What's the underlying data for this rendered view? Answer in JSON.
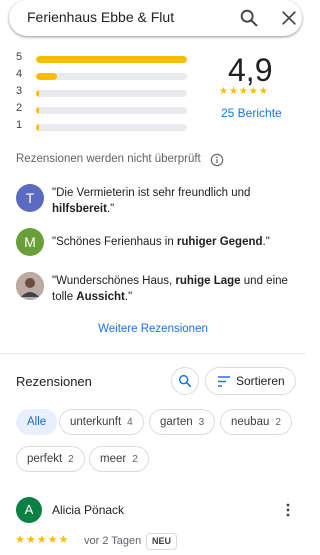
{
  "search": {
    "query": "Ferienhaus Ebbe & Flut",
    "search_icon": "search-icon",
    "close_icon": "close-icon"
  },
  "rating": {
    "score": "4,9",
    "stars_display": "★★★★★",
    "review_count_label": "25 Berichte",
    "star_color": "#fbbc04",
    "histogram": [
      {
        "stars": "5",
        "fraction": 1.0
      },
      {
        "stars": "4",
        "fraction": 0.14
      },
      {
        "stars": "3",
        "fraction": 0.01
      },
      {
        "stars": "2",
        "fraction": 0.01
      },
      {
        "stars": "1",
        "fraction": 0.01
      }
    ]
  },
  "unverified_notice": "Rezensionen werden nicht überprüft",
  "snippets": [
    {
      "avatar_letter": "T",
      "avatar_color": "#5c6bc0",
      "text_html": "\"Die Vermieterin ist sehr freundlich und <b>hilfsbereit</b>.\""
    },
    {
      "avatar_letter": "M",
      "avatar_color": "#689f38",
      "text_html": "\"Schönes Ferienhaus in <b>ruhiger Gegend</b>.\""
    },
    {
      "avatar_letter": "",
      "avatar_color": "#8d6e63",
      "text_html": "\"Wunderschönes Haus, <b>ruhige Lage</b> und eine tolle <b>Aussicht</b>.\""
    }
  ],
  "more_reviews_label": "Weitere Rezensionen",
  "reviews_section": {
    "title": "Rezensionen",
    "sort_label": "Sortieren",
    "chips": [
      {
        "label": "Alle",
        "count": "",
        "active": true
      },
      {
        "label": "unterkunft",
        "count": "4",
        "active": false
      },
      {
        "label": "garten",
        "count": "3",
        "active": false
      },
      {
        "label": "neubau",
        "count": "2",
        "active": false
      },
      {
        "label": "perfekt",
        "count": "2",
        "active": false
      },
      {
        "label": "meer",
        "count": "2",
        "active": false
      }
    ]
  },
  "review": {
    "author": "Alicia Pönack",
    "avatar_letter": "A",
    "avatar_color": "#0b8043",
    "stars_display": "★★★★★",
    "rating": 5,
    "date": "vor 2 Tagen",
    "badge": "NEU"
  },
  "accent_color": "#1a73e8"
}
